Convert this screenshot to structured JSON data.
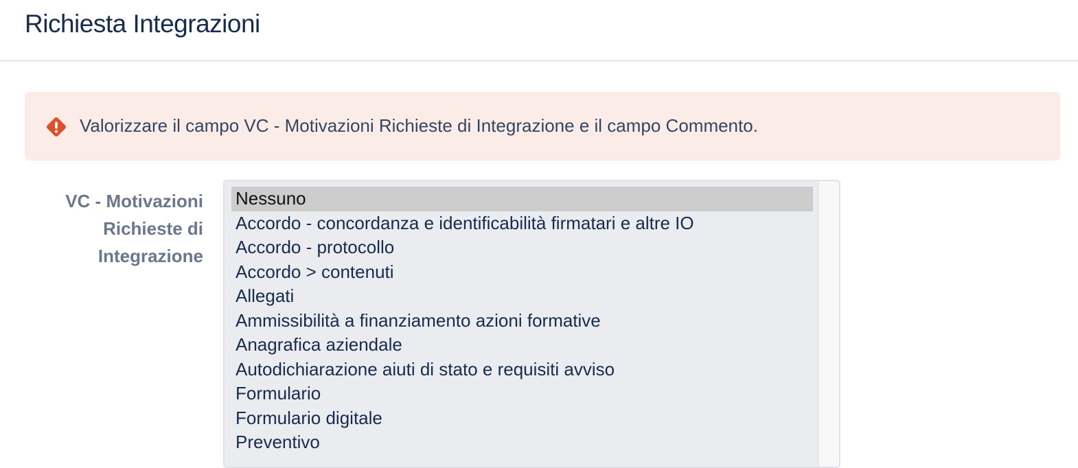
{
  "page": {
    "title": "Richiesta Integrazioni"
  },
  "error": {
    "icon": "error-diamond-icon",
    "icon_color": "#de4f2b",
    "background": "#fcece8",
    "message": "Valorizzare il campo VC - Motivazioni Richieste di Integrazione e il campo Commento."
  },
  "field": {
    "label_lines": [
      "VC - Motivazioni",
      "Richieste di",
      "Integrazione"
    ],
    "options": [
      "Nessuno",
      "Accordo - concordanza e identificabilità firmatari e altre IO",
      "Accordo - protocollo",
      "Accordo > contenuti",
      "Allegati",
      "Ammissibilità a finanziamento azioni formative",
      "Anagrafica aziendale",
      "Autodichiarazione aiuti di stato e requisiti avviso",
      "Formulario",
      "Formulario digitale",
      "Preventivo"
    ],
    "selected_option": "Nessuno"
  }
}
